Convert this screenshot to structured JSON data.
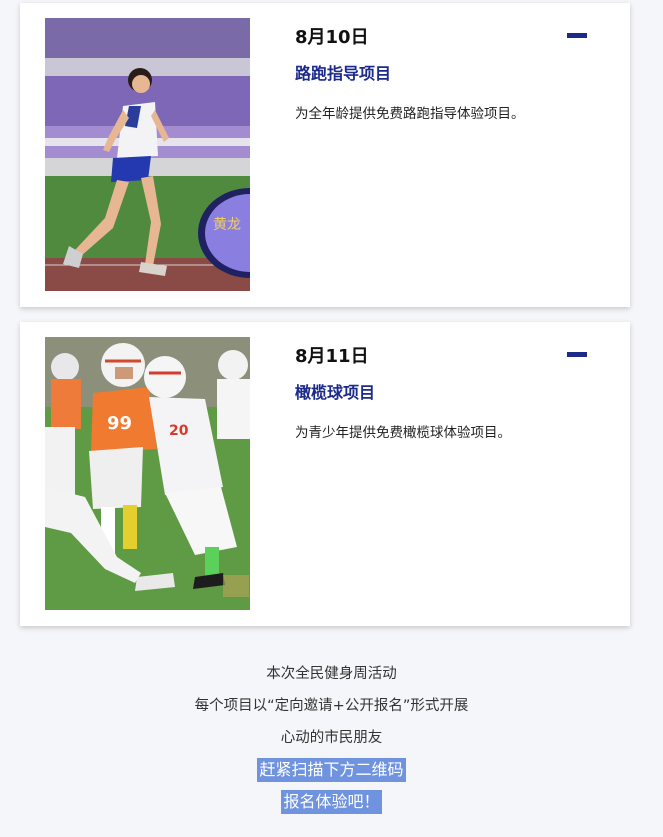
{
  "events": [
    {
      "date": "8月10日",
      "title": "路跑指导项目",
      "description": "为全年龄提供免费路跑指导体验项目。",
      "photo_banner_text": "黄龙"
    },
    {
      "date": "8月11日",
      "title": "橄榄球项目",
      "description": "为青少年提供免费橄榄球体验项目。",
      "photo_jersey_number": "99"
    }
  ],
  "footer": {
    "line1": "本次全民健身周活动",
    "line2": "每个项目以“定向邀请+公开报名”形式开展",
    "line3": "心动的市民朋友",
    "highlight1": "赶紧扫描下方二维码",
    "highlight2": "报名体验吧！"
  },
  "colors": {
    "accent": "#1c2a8c",
    "highlight": "#6f93de",
    "background": "#f5f6f9"
  },
  "icons": [
    "collapse-dash-icon"
  ]
}
